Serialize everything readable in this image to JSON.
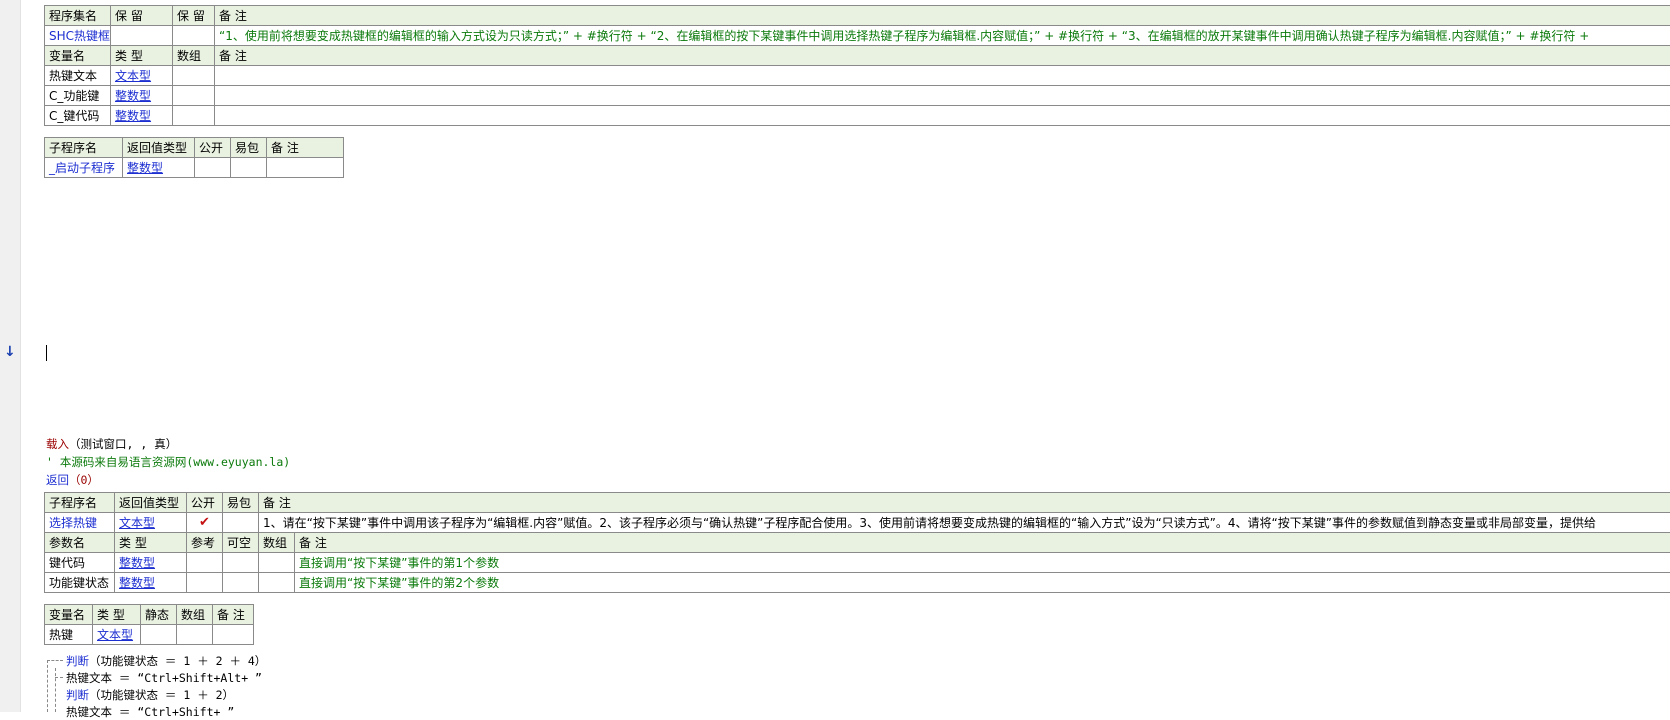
{
  "assembly_table": {
    "headers": [
      "程序集名",
      "保 留",
      "保 留",
      "备 注"
    ],
    "row": {
      "name": "SHC热键框",
      "reserved1": "",
      "reserved2": "",
      "comment": "“1、使用前将想要变成热键框的编辑框的输入方式设为只读方式；” + #换行符 + “2、在编辑框的按下某键事件中调用选择热键子程序为编辑框.内容赋值；” + #换行符 + “3、在编辑框的放开某键事件中调用确认热键子程序为编辑框.内容赋值；” + #换行符 +"
    },
    "var_headers": [
      "变量名",
      "类 型",
      "数组",
      "备 注"
    ],
    "vars": [
      {
        "name": "热键文本",
        "type": "文本型",
        "array": "",
        "comment": ""
      },
      {
        "name": "C_功能键",
        "type": "整数型",
        "array": "",
        "comment": ""
      },
      {
        "name": "C_键代码",
        "type": "整数型",
        "array": "",
        "comment": ""
      }
    ]
  },
  "startup_sub": {
    "headers": [
      "子程序名",
      "返回值类型",
      "公开",
      "易包",
      "备 注"
    ],
    "row": {
      "name": "_启动子程序",
      "return_type": "整数型",
      "public": "",
      "package": "",
      "comment": ""
    }
  },
  "code_lines": [
    {
      "keyword": "载入",
      "rest": "（测试窗口, , 真）"
    },
    {
      "comment": "' 本源码来自易语言资源网(www.eyuyan.la)"
    },
    {
      "keyword": "返回",
      "rest": "（0）"
    }
  ],
  "select_sub": {
    "headers": [
      "子程序名",
      "返回值类型",
      "公开",
      "易包",
      "备 注"
    ],
    "row": {
      "name": "选择热键",
      "return_type": "文本型",
      "public_mark": "✔",
      "package": "",
      "comment": "1、请在“按下某键”事件中调用该子程序为“编辑框.内容”赋值。2、该子程序必须与“确认热键”子程序配合使用。3、使用前请将想要变成热键的编辑框的“输入方式”设为“只读方式”。4、请将“按下某键”事件的参数赋值到静态变量或非局部变量，提供给"
    },
    "param_headers": [
      "参数名",
      "类 型",
      "参考",
      "可空",
      "数组",
      "备 注"
    ],
    "params": [
      {
        "name": "键代码",
        "type": "整数型",
        "comment": "直接调用“按下某键”事件的第1个参数"
      },
      {
        "name": "功能键状态",
        "type": "整数型",
        "comment": "直接调用“按下某键”事件的第2个参数"
      }
    ],
    "var_headers": [
      "变量名",
      "类 型",
      "静态",
      "数组",
      "备 注"
    ],
    "vars": [
      {
        "name": "热键",
        "type": "文本型",
        "static": "",
        "array": "",
        "comment": ""
      }
    ]
  },
  "body_lines": [
    {
      "keyword": "判断",
      "rest": "（功能键状态 ＝ 1 ＋ 2 ＋ 4）"
    },
    {
      "plain": "热键文本 ＝ “Ctrl+Shift+Alt+ ”"
    },
    {
      "keyword": "判断",
      "rest": "（功能键状态 ＝ 1 ＋ 2）"
    },
    {
      "plain": "热键文本 ＝ “Ctrl+Shift+ ”"
    }
  ]
}
